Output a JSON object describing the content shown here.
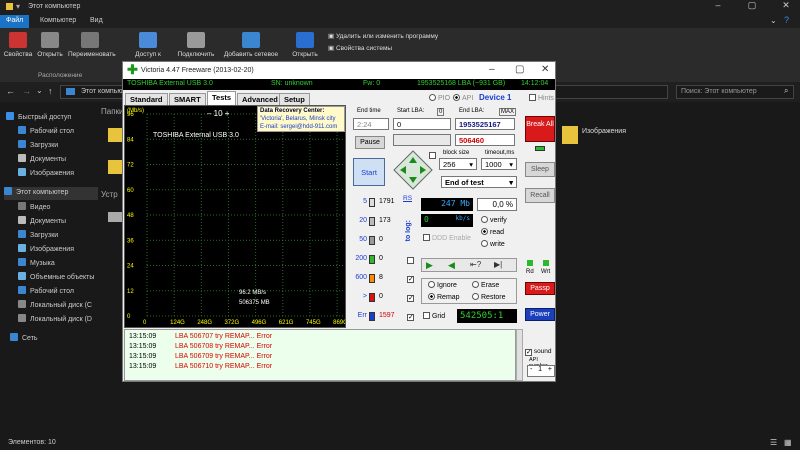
{
  "explorer": {
    "title": "Этот компьютер",
    "tabs": [
      "Файл",
      "Компьютер",
      "Вид"
    ],
    "ribbon": {
      "buttons": [
        "Свойства",
        "Открыть",
        "Переименовать",
        "Доступ к",
        "Подключить",
        "Добавить сетевое",
        "Открыть"
      ],
      "right_items": [
        "Удалить или изменить программу",
        "Свойства системы"
      ],
      "group_label": "Расположение"
    },
    "address": "Этот компьютер",
    "search_placeholder": "Поиск: Этот компьютер",
    "sidebar": [
      "Быстрый доступ",
      "Рабочий стол",
      "Загрузки",
      "Документы",
      "Изображения",
      "Этот компьютер",
      "Видео",
      "Документы",
      "Загрузки",
      "Изображения",
      "Музыка",
      "Объемные объекты",
      "Рабочий стол",
      "Локальный диск (С",
      "Локальный диск (D",
      "Сеть"
    ],
    "folder_partial": "Папки",
    "devices_partial": "Устр",
    "images_folder": "Изображения",
    "status": "Элементов: 10"
  },
  "victoria": {
    "title": "Victoria 4.47  Freeware (2013-02-20)",
    "device": "TOSHIBA External USB 3.0",
    "sn": "SN: unknown",
    "fw": "Fw: 0",
    "lba_size": "1953525168 LBA (~931 GB)",
    "time": "14:12:04",
    "tabs": [
      "Standard",
      "SMART",
      "Tests",
      "Advanced",
      "Setup"
    ],
    "active_tab": "Tests",
    "pio": "PIO",
    "api": "API",
    "device_label": "Device 1",
    "hints": "Hints",
    "graph": {
      "ylabel": "(Mb/s)",
      "yticks": [
        "96",
        "84",
        "72",
        "60",
        "48",
        "36",
        "24",
        "12",
        "0"
      ],
      "xticks": [
        "0",
        "124G",
        "248G",
        "372G",
        "496G",
        "621G",
        "745G",
        "869G"
      ],
      "zoom": "10",
      "drive_name": "TOSHIBA External USB 3.0",
      "speed_text": "96.2 MB/s",
      "block_text": "506375 MB",
      "drc": [
        "Data Recovery Center:",
        "'Victoria', Belarus, Minsk city",
        "E-mail: sergei@hdd-911.com"
      ]
    },
    "end_time_label": "End time",
    "end_time": "2:24",
    "start_lba_label": "Start LBA:",
    "start_lba": "0",
    "start_lba_small": "0",
    "end_lba_label": "End LBA:",
    "end_lba_max": "MAX",
    "end_lba": "1953525167",
    "current_lba": "506460",
    "pause": "Pause",
    "start": "Start",
    "block_size_label": "block size",
    "block_size": "256",
    "timeout_label": "timeout,ms",
    "timeout": "1000",
    "end_action": "End of test",
    "rs": "RS",
    "to_log": "to log:",
    "blocks": [
      {
        "ms": "5",
        "count": "1791",
        "color": "#dddddd"
      },
      {
        "ms": "20",
        "count": "173",
        "color": "#bbbbbb"
      },
      {
        "ms": "50",
        "count": "0",
        "color": "#999999"
      },
      {
        "ms": "200",
        "count": "0",
        "color": "#2db82d"
      },
      {
        "ms": "600",
        "count": "8",
        "color": "#ff8c00"
      },
      {
        "ms": ">",
        "count": "0",
        "color": "#e01010"
      },
      {
        "ms": "Err",
        "count": "1597",
        "color": "#1a3cd0"
      }
    ],
    "speed_mb": "247",
    "mb_unit": "Mb",
    "percent": "0,0",
    "pct_unit": "%",
    "kbs": "0",
    "kbs_unit": "kb/s",
    "verify": "verify",
    "read": "read",
    "write": "write",
    "ddd": "DDD Enable",
    "ignore": "Ignore",
    "erase": "Erase",
    "remap": "Remap",
    "restore": "Restore",
    "grid": "Grid",
    "lcd_value": "542505:1",
    "right_buttons": {
      "break": "Break All",
      "sleep": "Sleep",
      "recall": "Recall",
      "rd": "Rd",
      "wrt": "Wrt",
      "passp": "Passp",
      "power": "Power"
    },
    "sound": "sound",
    "api_number": "API number",
    "api_value": "1",
    "log": [
      {
        "time": "13:15:09",
        "msg": "LBA 506707 try REMAP... Error"
      },
      {
        "time": "13:15:09",
        "msg": "LBA 506708 try REMAP... Error"
      },
      {
        "time": "13:15:09",
        "msg": "LBA 506709 try REMAP... Error"
      },
      {
        "time": "13:15:09",
        "msg": "LBA 506710 try REMAP... Error"
      }
    ]
  }
}
